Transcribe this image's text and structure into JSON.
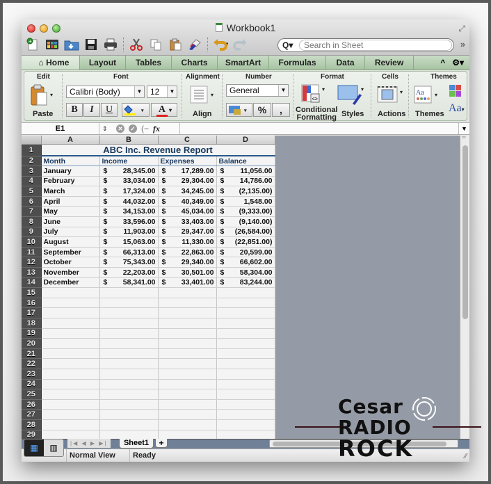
{
  "window": {
    "title": "Workbook1"
  },
  "toolbar": {
    "search_placeholder": "Search in Sheet",
    "icons": [
      "new-workbook-icon",
      "templates-icon",
      "open-icon",
      "save-icon",
      "print-icon",
      "cut-icon",
      "copy-icon",
      "paste-icon",
      "format-painter-icon",
      "undo-icon",
      "redo-icon"
    ]
  },
  "ribbon": {
    "tabs": [
      {
        "label": "Home",
        "active": true
      },
      {
        "label": "Layout"
      },
      {
        "label": "Tables"
      },
      {
        "label": "Charts"
      },
      {
        "label": "SmartArt"
      },
      {
        "label": "Formulas"
      },
      {
        "label": "Data"
      },
      {
        "label": "Review"
      }
    ],
    "groups": {
      "edit": "Edit",
      "font": "Font",
      "alignment": "Alignment",
      "number": "Number",
      "format": "Format",
      "cells": "Cells",
      "themes": "Themes"
    },
    "paste_label": "Paste",
    "font_name": "Calibri (Body)",
    "font_size": "12",
    "bold": "B",
    "italic": "I",
    "underline": "U",
    "font_color_glyph": "A",
    "align_label": "Align",
    "number_format": "General",
    "percent": "%",
    "comma": ",",
    "conditional_formatting": "Conditional",
    "conditional_formatting_2": "Formatting",
    "styles_label": "Styles",
    "actions_label": "Actions",
    "themes_label": "Themes",
    "theme_fonts_glyph": "Aa"
  },
  "formula_bar": {
    "name_box": "E1",
    "fx": "fx",
    "value": ""
  },
  "sheet": {
    "columns": [
      "A",
      "B",
      "C",
      "D"
    ],
    "title": "ABC Inc. Revenue Report",
    "headers": [
      "Month",
      "Income",
      "Expenses",
      "Balance"
    ],
    "currency_symbol": "$",
    "rows": [
      {
        "month": "January",
        "income": "28,345.00",
        "expenses": "17,289.00",
        "balance": "11,056.00"
      },
      {
        "month": "February",
        "income": "33,034.00",
        "expenses": "29,304.00",
        "balance": "14,786.00"
      },
      {
        "month": "March",
        "income": "17,324.00",
        "expenses": "34,245.00",
        "balance": "(2,135.00)"
      },
      {
        "month": "April",
        "income": "44,032.00",
        "expenses": "40,349.00",
        "balance": "1,548.00"
      },
      {
        "month": "May",
        "income": "34,153.00",
        "expenses": "45,034.00",
        "balance": "(9,333.00)"
      },
      {
        "month": "June",
        "income": "33,596.00",
        "expenses": "33,403.00",
        "balance": "(9,140.00)"
      },
      {
        "month": "July",
        "income": "11,903.00",
        "expenses": "29,347.00",
        "balance": "(26,584.00)"
      },
      {
        "month": "August",
        "income": "15,063.00",
        "expenses": "11,330.00",
        "balance": "(22,851.00)"
      },
      {
        "month": "September",
        "income": "66,313.00",
        "expenses": "22,863.00",
        "balance": "20,599.00"
      },
      {
        "month": "October",
        "income": "75,343.00",
        "expenses": "29,340.00",
        "balance": "66,602.00"
      },
      {
        "month": "November",
        "income": "22,203.00",
        "expenses": "30,501.00",
        "balance": "58,304.00"
      },
      {
        "month": "December",
        "income": "58,341.00",
        "expenses": "33,401.00",
        "balance": "83,244.00"
      }
    ],
    "empty_row_numbers": [
      15,
      16,
      17,
      18,
      19,
      20,
      21,
      22,
      23,
      24,
      25,
      26,
      27,
      28,
      29
    ],
    "tab_name": "Sheet1",
    "add_sheet": "+"
  },
  "status_bar": {
    "view": "Normal View",
    "state": "Ready"
  },
  "watermark": {
    "line1": "Cesar",
    "line2": "RADIO",
    "line3": "ROCK"
  }
}
